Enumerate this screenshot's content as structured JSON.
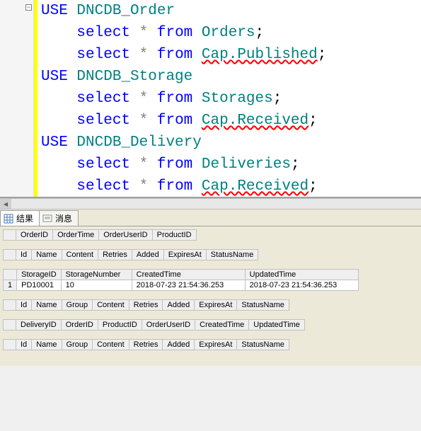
{
  "code": {
    "lines": [
      {
        "t": "USE DNCDB_Order",
        "ind": 0,
        "type": "use"
      },
      {
        "t": "select * from Orders;",
        "ind": 1,
        "type": "sel",
        "target": "Orders"
      },
      {
        "t": "select * from Cap.Published;",
        "ind": 1,
        "type": "sel",
        "target": "Cap.Published",
        "squig": true
      },
      {
        "t": "USE DNCDB_Storage",
        "ind": 0,
        "type": "use"
      },
      {
        "t": "select * from Storages;",
        "ind": 1,
        "type": "sel",
        "target": "Storages"
      },
      {
        "t": "select * from Cap.Received;",
        "ind": 1,
        "type": "sel",
        "target": "Cap.Received",
        "squig": true
      },
      {
        "t": "USE DNCDB_Delivery",
        "ind": 0,
        "type": "use"
      },
      {
        "t": "select * from Deliveries;",
        "ind": 1,
        "type": "sel",
        "target": "Deliveries"
      },
      {
        "t": "select * from Cap.Received;",
        "ind": 1,
        "type": "sel",
        "target": "Cap.Received",
        "squig": true
      }
    ]
  },
  "tabs": {
    "results": "结果",
    "messages": "消息"
  },
  "grids": [
    {
      "headers": [
        "OrderID",
        "OrderTime",
        "OrderUserID",
        "ProductID"
      ],
      "rows": []
    },
    {
      "headers": [
        "Id",
        "Name",
        "Content",
        "Retries",
        "Added",
        "ExpiresAt",
        "StatusName"
      ],
      "rows": []
    },
    {
      "headers": [
        "StorageID",
        "StorageNumber",
        "CreatedTime",
        "UpdatedTime"
      ],
      "rows": [
        {
          "num": "1",
          "cells": [
            "PD10001",
            "10",
            "2018-07-23 21:54:36.253",
            "2018-07-23 21:54:36.253"
          ]
        }
      ]
    },
    {
      "headers": [
        "Id",
        "Name",
        "Group",
        "Content",
        "Retries",
        "Added",
        "ExpiresAt",
        "StatusName"
      ],
      "rows": []
    },
    {
      "headers": [
        "DeliveryID",
        "OrderID",
        "ProductID",
        "OrderUserID",
        "CreatedTime",
        "UpdatedTime"
      ],
      "rows": []
    },
    {
      "headers": [
        "Id",
        "Name",
        "Group",
        "Content",
        "Retries",
        "Added",
        "ExpiresAt",
        "StatusName"
      ],
      "rows": []
    }
  ]
}
